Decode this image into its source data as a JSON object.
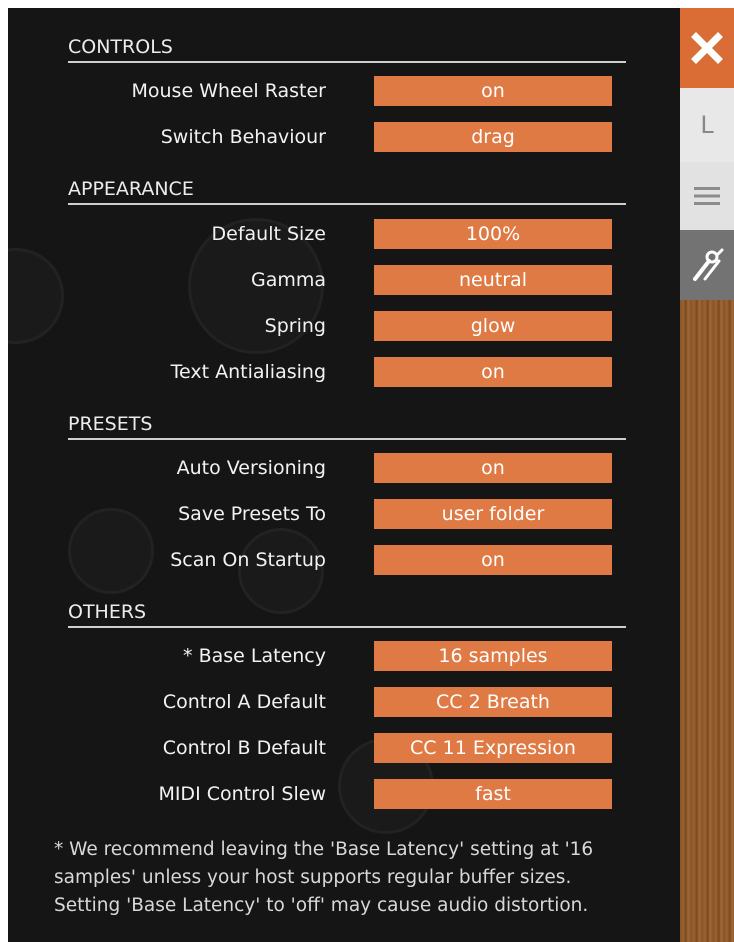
{
  "sections": [
    {
      "title": "CONTROLS",
      "rows": [
        {
          "label": "Mouse Wheel Raster",
          "value": "on"
        },
        {
          "label": "Switch Behaviour",
          "value": "drag"
        }
      ]
    },
    {
      "title": "APPEARANCE",
      "rows": [
        {
          "label": "Default Size",
          "value": "100%"
        },
        {
          "label": "Gamma",
          "value": "neutral"
        },
        {
          "label": "Spring",
          "value": "glow"
        },
        {
          "label": "Text Antialiasing",
          "value": "on"
        }
      ]
    },
    {
      "title": "PRESETS",
      "rows": [
        {
          "label": "Auto Versioning",
          "value": "on"
        },
        {
          "label": "Save Presets To",
          "value": "user folder"
        },
        {
          "label": "Scan On Startup",
          "value": "on"
        }
      ]
    },
    {
      "title": "OTHERS",
      "rows": [
        {
          "label": "* Base Latency",
          "value": "16 samples"
        },
        {
          "label": "Control A Default",
          "value": "CC 2 Breath"
        },
        {
          "label": "Control B Default",
          "value": "CC 11 Expression"
        },
        {
          "label": "MIDI Control Slew",
          "value": "fast"
        }
      ]
    }
  ],
  "footnote": [
    "* We recommend leaving the 'Base Latency' setting at '16",
    "samples' unless your host supports regular buffer sizes.",
    "Setting 'Base Latency' to 'off' may cause audio distortion."
  ],
  "tabs": {
    "close_icon": "close-icon",
    "l_label": "L",
    "menu_icon": "hamburger-menu-icon",
    "tools_icon": "wrench-screwdriver-icon"
  },
  "colors": {
    "accent": "#e07a45",
    "panel_bg": "#151515",
    "close_tab": "#d96d35"
  }
}
